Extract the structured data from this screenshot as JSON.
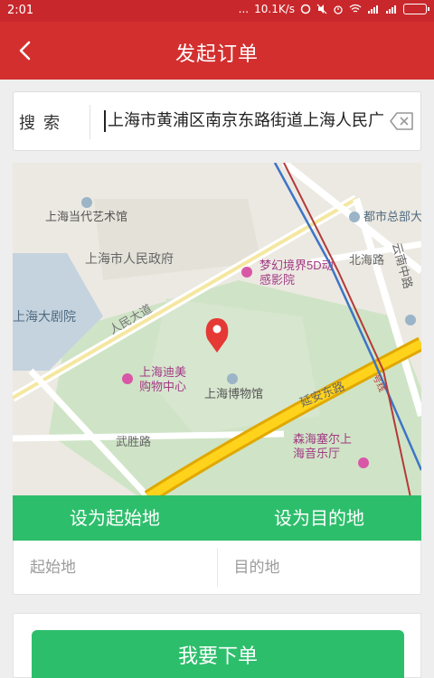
{
  "status_bar": {
    "time": "2:01",
    "dots": "...",
    "network_speed": "10.1K/s"
  },
  "app_bar": {
    "title": "发起订单"
  },
  "search": {
    "label": "搜索",
    "value": "上海市黄浦区南京东路街道上海人民广"
  },
  "map": {
    "labels": {
      "contemporary_art": "上海当代艺术馆",
      "city_gov": "上海市人民政府",
      "grand_theatre": "上海大剧院",
      "renmin_avenue": "人民大道",
      "fantasy_cinema_1": "梦幻境界5D动",
      "fantasy_cinema_2": "感影院",
      "museum": "上海博物馆",
      "dimei_1": "上海迪美",
      "dimei_2": "购物中心",
      "wusheng_road": "武胜路",
      "yanan_road": "延安东路",
      "dushi": "都市总部大",
      "beihai_road": "北海路",
      "yunnan_road": "云南中路",
      "concert_1": "森海塞尔上",
      "concert_2": "海音乐厅",
      "metro_line": "号线"
    }
  },
  "actions": {
    "set_start": "设为起始地",
    "set_dest": "设为目的地"
  },
  "fields": {
    "start_placeholder": "起始地",
    "dest_placeholder": "目的地"
  },
  "submit": {
    "label": "我要下单"
  },
  "colors": {
    "status_bar": "#c8282c",
    "app_bar": "#d32f2f",
    "accent_green": "#2dbe6c",
    "pin": "#e53935"
  }
}
